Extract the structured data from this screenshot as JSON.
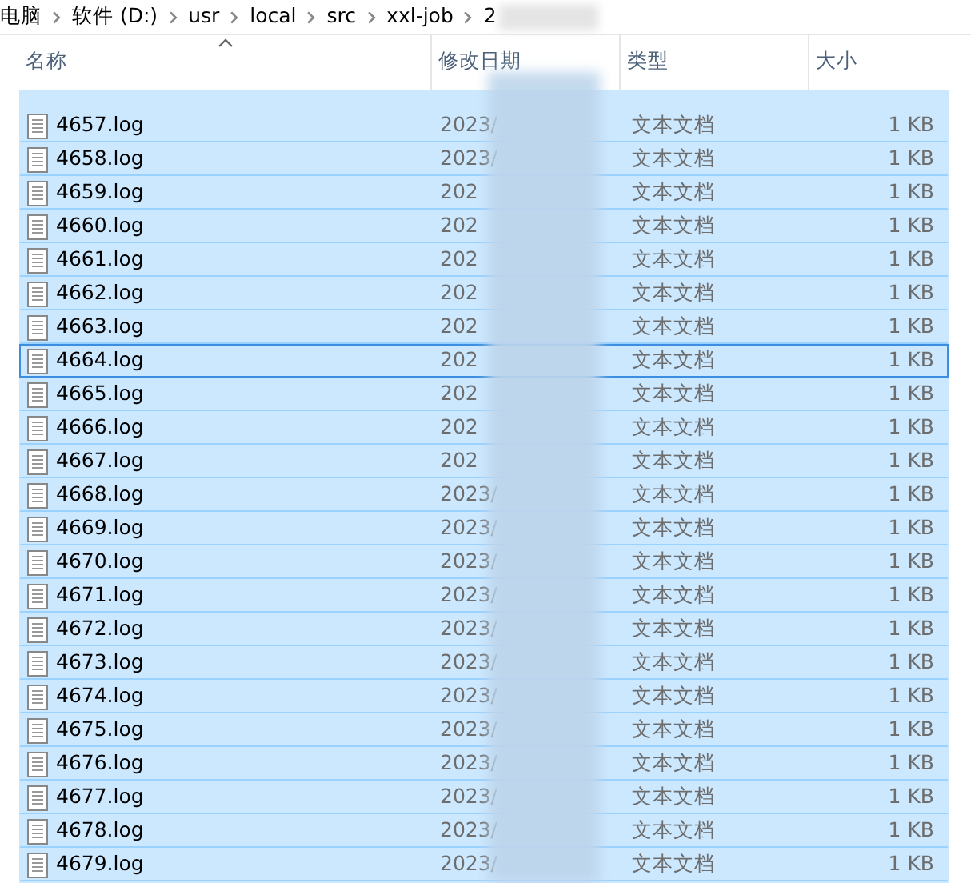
{
  "breadcrumb": [
    "电脑",
    "软件 (D:)",
    "usr",
    "local",
    "src",
    "xxl-job",
    "2"
  ],
  "table": {
    "columns": [
      {
        "label": "名称",
        "sorted": true
      },
      {
        "label": "修改日期",
        "sorted": false
      },
      {
        "label": "类型",
        "sorted": false
      },
      {
        "label": "大小",
        "sorted": false
      }
    ],
    "rows": [
      {
        "name": "4657.log",
        "date": "2023/",
        "type": "文本文档",
        "size": "1 KB",
        "selected": true,
        "focused": false
      },
      {
        "name": "4658.log",
        "date": "2023/",
        "type": "文本文档",
        "size": "1 KB",
        "selected": true,
        "focused": false
      },
      {
        "name": "4659.log",
        "date": "202",
        "type": "文本文档",
        "size": "1 KB",
        "selected": true,
        "focused": false
      },
      {
        "name": "4660.log",
        "date": "202",
        "type": "文本文档",
        "size": "1 KB",
        "selected": true,
        "focused": false
      },
      {
        "name": "4661.log",
        "date": "202",
        "type": "文本文档",
        "size": "1 KB",
        "selected": true,
        "focused": false
      },
      {
        "name": "4662.log",
        "date": "202",
        "type": "文本文档",
        "size": "1 KB",
        "selected": true,
        "focused": false
      },
      {
        "name": "4663.log",
        "date": "202",
        "type": "文本文档",
        "size": "1 KB",
        "selected": true,
        "focused": false
      },
      {
        "name": "4664.log",
        "date": "202",
        "type": "文本文档",
        "size": "1 KB",
        "selected": true,
        "focused": true
      },
      {
        "name": "4665.log",
        "date": "202",
        "type": "文本文档",
        "size": "1 KB",
        "selected": true,
        "focused": false
      },
      {
        "name": "4666.log",
        "date": "202",
        "type": "文本文档",
        "size": "1 KB",
        "selected": true,
        "focused": false
      },
      {
        "name": "4667.log",
        "date": "202",
        "type": "文本文档",
        "size": "1 KB",
        "selected": true,
        "focused": false
      },
      {
        "name": "4668.log",
        "date": "2023/",
        "type": "文本文档",
        "size": "1 KB",
        "selected": true,
        "focused": false
      },
      {
        "name": "4669.log",
        "date": "2023/",
        "type": "文本文档",
        "size": "1 KB",
        "selected": true,
        "focused": false
      },
      {
        "name": "4670.log",
        "date": "2023/",
        "type": "文本文档",
        "size": "1 KB",
        "selected": true,
        "focused": false
      },
      {
        "name": "4671.log",
        "date": "2023/",
        "type": "文本文档",
        "size": "1 KB",
        "selected": true,
        "focused": false
      },
      {
        "name": "4672.log",
        "date": "2023/",
        "type": "文本文档",
        "size": "1 KB",
        "selected": true,
        "focused": false
      },
      {
        "name": "4673.log",
        "date": "2023/",
        "type": "文本文档",
        "size": "1 KB",
        "selected": true,
        "focused": false
      },
      {
        "name": "4674.log",
        "date": "2023/",
        "type": "文本文档",
        "size": "1 KB",
        "selected": true,
        "focused": false
      },
      {
        "name": "4675.log",
        "date": "2023/",
        "type": "文本文档",
        "size": "1 KB",
        "selected": true,
        "focused": false
      },
      {
        "name": "4676.log",
        "date": "2023/",
        "type": "文本文档",
        "size": "1 KB",
        "selected": true,
        "focused": false
      },
      {
        "name": "4677.log",
        "date": "2023/",
        "type": "文本文档",
        "size": "1 KB",
        "selected": true,
        "focused": false
      },
      {
        "name": "4678.log",
        "date": "2023/",
        "type": "文本文档",
        "size": "1 KB",
        "selected": true,
        "focused": false
      },
      {
        "name": "4679.log",
        "date": "2023/",
        "type": "文本文档",
        "size": "1 KB",
        "selected": true,
        "focused": false
      }
    ]
  }
}
